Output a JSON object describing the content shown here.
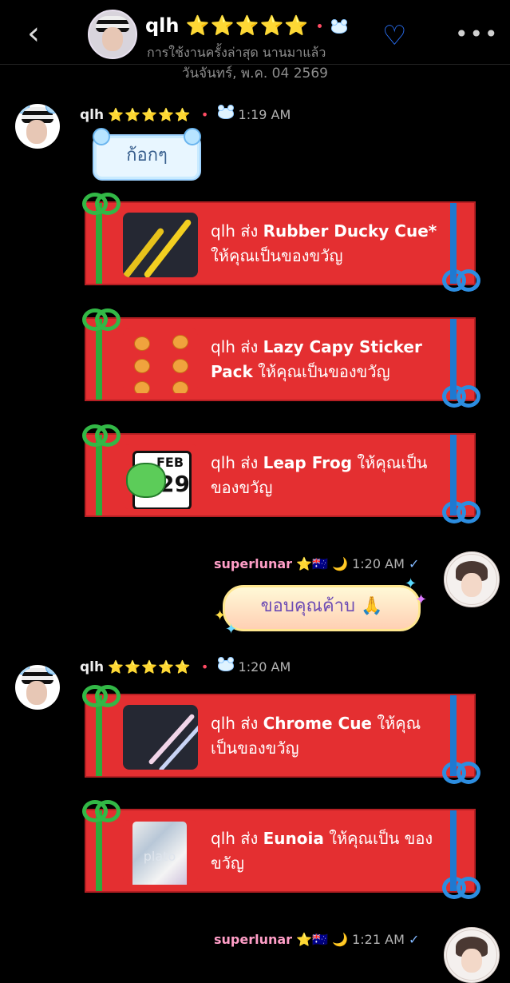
{
  "header": {
    "back_icon": "chevron-left-icon",
    "name": "qlh",
    "stars": "⭐⭐⭐⭐⭐",
    "bear_badge": "cloud-bear-icon",
    "status": "การใช้งานครั้งล่าสุด นานมาแล้ว",
    "heart_icon": "heart-outline-icon",
    "more_icon": "more-horizontal-icon"
  },
  "date_label": "วันจันทร์, พ.ค. 04 2569",
  "messages": [
    {
      "sender": "qlh",
      "stars": "⭐⭐⭐⭐⭐",
      "time": "1:19 AM",
      "text": "ก้อกๆ"
    },
    {
      "sender": "qlh",
      "gift_prefix": "qlh ส่ง ",
      "gift_name": "Rubber Ducky Cue*",
      "gift_suffix": " ให้คุณเป็นของขวัญ"
    },
    {
      "sender": "qlh",
      "gift_prefix": "qlh ส่ง ",
      "gift_name": "Lazy Capy Sticker Pack",
      "gift_suffix": " ให้คุณเป็นของขวัญ"
    },
    {
      "sender": "qlh",
      "gift_prefix": "qlh ส่ง ",
      "gift_name": "Leap Frog",
      "gift_suffix": " ให้คุณเป็น ของขวัญ"
    },
    {
      "sender": "superlunar",
      "badges": "⭐🇦🇺",
      "time": "1:20 AM",
      "text": "ขอบคุณค้าบ 🙏"
    },
    {
      "sender": "qlh",
      "stars": "⭐⭐⭐⭐⭐",
      "time": "1:20 AM",
      "gift_prefix": "qlh ส่ง ",
      "gift_name": "Chrome Cue",
      "gift_suffix": " ให้คุณ เป็นของขวัญ"
    },
    {
      "sender": "qlh",
      "gift_prefix": "qlh ส่ง ",
      "gift_name": "Eunoia",
      "gift_suffix": " ให้คุณเป็น ของขวัญ"
    },
    {
      "sender": "superlunar",
      "badges": "⭐🇦🇺",
      "time": "1:21 AM"
    }
  ],
  "item_labels": {
    "calendar_month": "FEB",
    "calendar_day": "29",
    "plato": "plato"
  },
  "colors": {
    "background": "#000000",
    "gift_red": "#e42f31",
    "gift_green": "#2cac3b",
    "gift_blue": "#1e79d1",
    "accent_blue": "#2b74ff"
  }
}
